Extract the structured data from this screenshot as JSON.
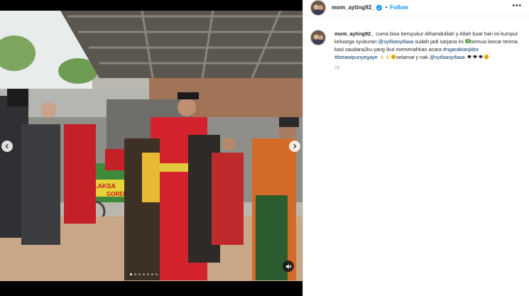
{
  "post": {
    "username": "mom_ayting92_",
    "separator": "•",
    "follow_label": "Follow",
    "more_label": "•••",
    "caption_parts": [
      {
        "type": "text",
        "value": "cuma bisa bersyukur Alhamdulilah y Allah buat hari ini kumpul keluarga syukuran "
      },
      {
        "type": "link",
        "value": "@syifaasyifaaa"
      },
      {
        "type": "text",
        "value": " sudah jadi sarjana ini "
      },
      {
        "type": "emoji",
        "value": "money-emoji"
      },
      {
        "type": "text",
        "value": "semua lancar terima kasi saudara2ku yang ikut memeriahkan acara "
      },
      {
        "type": "link",
        "value": "#ngaraktanjidor"
      },
      {
        "type": "text",
        "value": " "
      },
      {
        "type": "link",
        "value": "#betawipunyegaye"
      },
      {
        "type": "text",
        "value": " "
      },
      {
        "type": "emoji",
        "value": "pray-emoji"
      },
      {
        "type": "emoji",
        "value": "pray-emoji"
      },
      {
        "type": "emoji",
        "value": "smile-emoji"
      },
      {
        "type": "text",
        "value": "selamat y nak "
      },
      {
        "type": "link",
        "value": "@syifaasyifaaa"
      },
      {
        "type": "text",
        "value": " "
      },
      {
        "type": "emoji",
        "value": "grad-cap-emoji"
      },
      {
        "type": "emoji",
        "value": "grad-cap-emoji"
      },
      {
        "type": "emoji",
        "value": "grad-cap-emoji"
      },
      {
        "type": "emoji",
        "value": "smile-emoji"
      }
    ],
    "time": "1h"
  },
  "media": {
    "slide_count": 7,
    "active_slide": 0,
    "icons": {
      "prev": "chevron-left-icon",
      "next": "chevron-right-icon",
      "mute": "speaker-muted-icon",
      "verified": "verified-badge-icon"
    },
    "banner_text": "LAKSA",
    "banner_text2": "GORENG"
  },
  "colors": {
    "link": "#00376b",
    "follow": "#0095f6",
    "verified": "#0095f6",
    "text": "#262626",
    "muted": "#8e8e8e"
  }
}
